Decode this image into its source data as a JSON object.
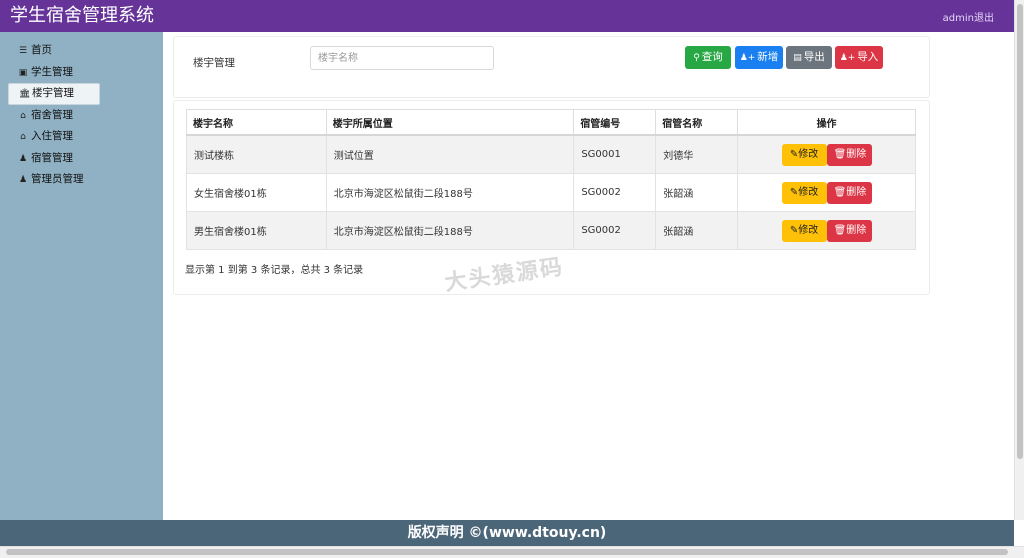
{
  "header": {
    "title": "学生宿舍管理系统",
    "user": "admin",
    "logout": "退出"
  },
  "sidebar": {
    "items": [
      {
        "label": "首页",
        "icon": "bars-icon"
      },
      {
        "label": "学生管理",
        "icon": "id-card-icon"
      },
      {
        "label": "楼宇管理",
        "icon": "building-icon",
        "active": true
      },
      {
        "label": "宿舍管理",
        "icon": "home-icon"
      },
      {
        "label": "入住管理",
        "icon": "home-icon"
      },
      {
        "label": "宿管管理",
        "icon": "user-icon"
      },
      {
        "label": "管理员管理",
        "icon": "user-icon"
      }
    ]
  },
  "search": {
    "label": "楼宇管理",
    "placeholder": "楼宇名称",
    "value": ""
  },
  "toolbar": {
    "query": "查询",
    "add": "新增",
    "export": "导出",
    "import": "导入"
  },
  "table": {
    "columns": [
      "楼宇名称",
      "楼宇所属位置",
      "宿管编号",
      "宿管名称",
      "操作"
    ],
    "rows": [
      {
        "name": "测试楼栋",
        "location": "测试位置",
        "manager_id": "SG0001",
        "manager_name": "刘德华"
      },
      {
        "name": "女生宿舍楼01栋",
        "location": "北京市海淀区松鼠街二段188号",
        "manager_id": "SG0002",
        "manager_name": "张韶涵"
      },
      {
        "name": "男生宿舍楼01栋",
        "location": "北京市海淀区松鼠街二段188号",
        "manager_id": "SG0002",
        "manager_name": "张韶涵"
      }
    ],
    "edit_label": "修改",
    "delete_label": "删除"
  },
  "pagination": {
    "summary": "显示第 1 到第 3 条记录，总共 3 条记录"
  },
  "watermark": "大头猿源码",
  "footer": {
    "text": "版权声明 ©(www.dtouy.cn)"
  },
  "colors": {
    "header_bg": "#663399",
    "sidebar_bg": "#8fb1c3",
    "footer_bg": "#4c6679",
    "query_btn": "#28a745",
    "add_btn": "#1a7ff0",
    "export_btn": "#6c757d",
    "import_btn": "#dc3545",
    "edit_btn": "#ffc107",
    "delete_btn": "#dc3545"
  }
}
